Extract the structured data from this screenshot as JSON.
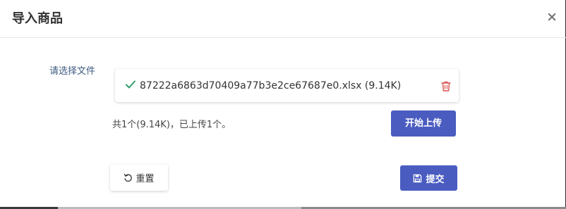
{
  "modal": {
    "title": "导入商品",
    "close_label": "×"
  },
  "form": {
    "file_label": "请选择文件",
    "file": {
      "name": "87222a6863d70409a77b3e2ce67687e0.xlsx (9.14K)",
      "status_icon": "check-icon",
      "delete_icon": "trash-icon"
    },
    "summary": "共1个(9.14K)，已上传1个。",
    "upload_button": "开始上传",
    "reset_button": "重置",
    "submit_button": "提交"
  },
  "colors": {
    "primary": "#4a5cc0",
    "success": "#2e9e6a",
    "danger": "#d9534f",
    "label": "#3d5a80"
  }
}
